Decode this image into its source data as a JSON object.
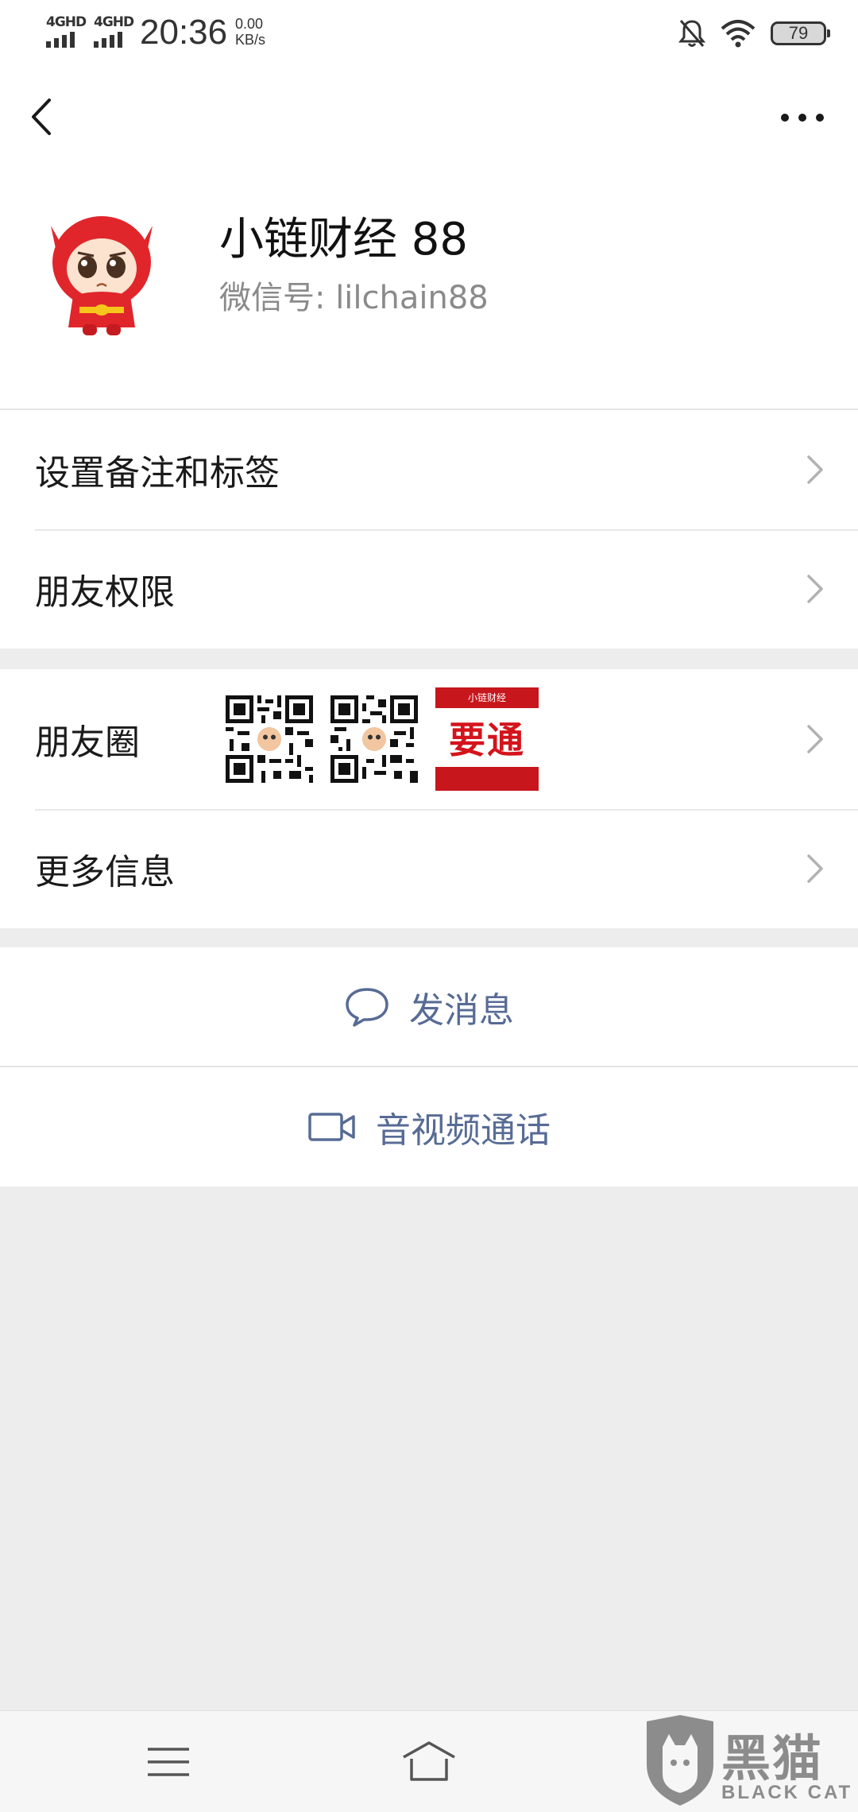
{
  "status_bar": {
    "network_1": "4GHD",
    "network_2": "4GHD",
    "time": "20:36",
    "speed_value": "0.00",
    "speed_unit": "KB/s",
    "battery": "79",
    "icons": [
      "mute-bell-icon",
      "wifi-icon",
      "battery-icon"
    ]
  },
  "nav": {
    "back_icon": "chevron-left-icon",
    "more_icon": "more-dots-icon"
  },
  "profile": {
    "name": "小链财经 88",
    "wechat_id": "微信号: lilchain88"
  },
  "menu": {
    "remark_tags": "设置备注和标签",
    "friend_permissions": "朋友权限",
    "moments": "朋友圈",
    "more_info": "更多信息"
  },
  "moments_thumbs": {
    "promo_text": "要通",
    "promo_brand": "小链财经"
  },
  "actions": {
    "send_message": "发消息",
    "video_call": "音视频通话"
  },
  "colors": {
    "link_blue": "#576b95",
    "background": "#ededed",
    "avatar_red": "#e0262b"
  },
  "watermark": {
    "main": "黑猫",
    "sub": "BLACK CAT"
  }
}
